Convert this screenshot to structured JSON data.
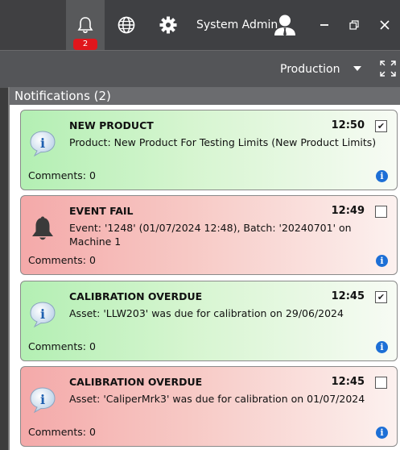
{
  "titlebar": {
    "notification_count": "2",
    "user_name": "System Admin"
  },
  "subbar": {
    "selected_view": "Production"
  },
  "panel": {
    "header": "Notifications (2)"
  },
  "notifications": [
    {
      "status": "ok",
      "icon": "info-icon",
      "title": "NEW PRODUCT",
      "time": "12:50",
      "checked": "✔",
      "message": "Product: New Product For Testing Limits (New Product Limits)",
      "comments": "Comments: 0"
    },
    {
      "status": "fail",
      "icon": "bell-alert-icon",
      "title": "EVENT FAIL",
      "time": "12:49",
      "checked": "",
      "message": "Event: '1248' (01/07/2024 12:48), Batch: '20240701' on Machine 1",
      "comments": "Comments: 0"
    },
    {
      "status": "ok",
      "icon": "info-icon",
      "title": "CALIBRATION OVERDUE",
      "time": "12:45",
      "checked": "✔",
      "message": "Asset: 'LLW203' was due for calibration on 29/06/2024",
      "comments": "Comments: 0"
    },
    {
      "status": "fail",
      "icon": "info-icon",
      "title": "CALIBRATION OVERDUE",
      "time": "12:45",
      "checked": "",
      "message": "Asset: 'CaliperMrk3' was due for calibration on 01/07/2024",
      "comments": "Comments: 0"
    }
  ],
  "colors": {
    "accent_badge": "#e0161c",
    "info_blue": "#1d6fd6",
    "ok_green": "#b3efb3",
    "fail_red": "#f4a9a9"
  }
}
